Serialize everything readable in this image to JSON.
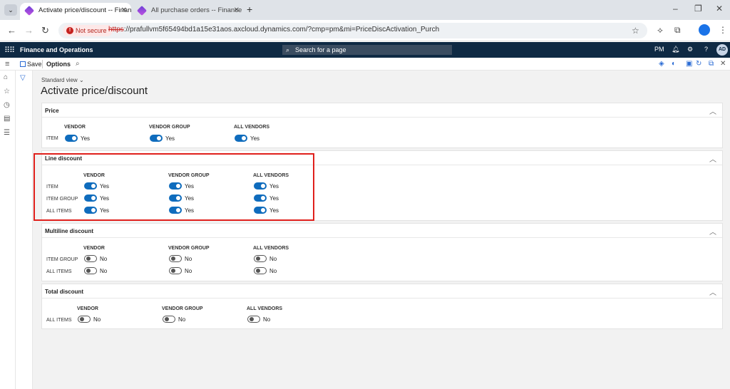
{
  "browser": {
    "tabs": [
      {
        "title": "Activate price/discount -- Finan"
      },
      {
        "title": "All purchase orders -- Finance a"
      }
    ],
    "new_tab": "+",
    "security_label": "Not secure",
    "url_proto": "https",
    "url_rest": "://prafullvm5f65494bd1a15e31aos.axcloud.dynamics.com/?cmp=pm&mi=PriceDiscActivation_Purch"
  },
  "app": {
    "title": "Finance and Operations",
    "search_placeholder": "Search for a page",
    "company": "PM",
    "avatar": "AD"
  },
  "actionpane": {
    "save": "Save",
    "options": "Options"
  },
  "page": {
    "view": "Standard view",
    "title": "Activate price/discount"
  },
  "sections": {
    "price": {
      "title": "Price",
      "cols": [
        "VENDOR",
        "VENDOR GROUP",
        "ALL VENDORS"
      ],
      "rows": [
        {
          "label": "ITEM",
          "vals": [
            "Yes",
            "Yes",
            "Yes"
          ]
        }
      ]
    },
    "line": {
      "title": "Line discount",
      "cols": [
        "VENDOR",
        "VENDOR GROUP",
        "ALL VENDORS"
      ],
      "rows": [
        {
          "label": "ITEM",
          "vals": [
            "Yes",
            "Yes",
            "Yes"
          ]
        },
        {
          "label": "ITEM GROUP",
          "vals": [
            "Yes",
            "Yes",
            "Yes"
          ]
        },
        {
          "label": "ALL ITEMS",
          "vals": [
            "Yes",
            "Yes",
            "Yes"
          ]
        }
      ]
    },
    "multiline": {
      "title": "Multiline discount",
      "cols": [
        "VENDOR",
        "VENDOR GROUP",
        "ALL VENDORS"
      ],
      "rows": [
        {
          "label": "ITEM GROUP",
          "vals": [
            "No",
            "No",
            "No"
          ]
        },
        {
          "label": "ALL ITEMS",
          "vals": [
            "No",
            "No",
            "No"
          ]
        }
      ]
    },
    "total": {
      "title": "Total discount",
      "cols": [
        "VENDOR",
        "VENDOR GROUP",
        "ALL VENDORS"
      ],
      "rows": [
        {
          "label": "ALL ITEMS",
          "vals": [
            "No",
            "No",
            "No"
          ]
        }
      ]
    }
  },
  "colors": {
    "toggle_on": "#0f6cbd",
    "header_bg": "#0f2a44",
    "highlight": "#e0201c"
  }
}
